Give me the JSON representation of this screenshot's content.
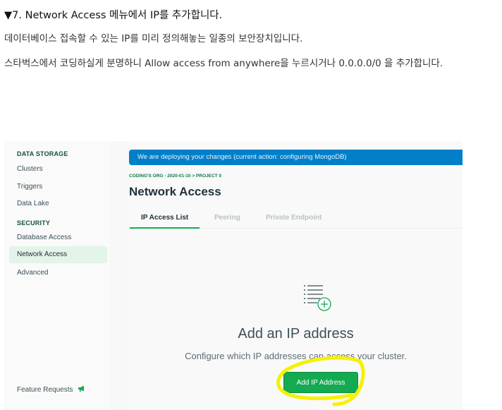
{
  "article": {
    "heading": "▼7. Network Access 메뉴에서 IP를 추가합니다.",
    "para1": "데이터베이스 접속할 수 있는 IP를 미리 정의해놓는 일종의 보안장치입니다.",
    "para2": "스타벅스에서 코딩하실게 분명하니 Allow access from anywhere을 누르시거나 0.0.0.0/0 을 추가합니다."
  },
  "sidebar": {
    "data_storage": "DATA STORAGE",
    "clusters": "Clusters",
    "triggers": "Triggers",
    "data_lake": "Data Lake",
    "security": "SECURITY",
    "database_access": "Database Access",
    "network_access": "Network Access",
    "advanced": "Advanced",
    "feature_requests": "Feature Requests"
  },
  "main": {
    "banner": "We are deploying your changes (current action: configuring MongoDB)",
    "breadcrumb": "CODING'S ORG - 2020-01-10 > PROJECT 0",
    "title": "Network Access",
    "tabs": [
      "IP Access List",
      "Peering",
      "Private Endpoint"
    ],
    "empty_title": "Add an IP address",
    "empty_desc": "Configure which IP addresses can access your cluster.",
    "add_button": "Add IP Address"
  },
  "colors": {
    "accent": "#13aa52",
    "banner": "#017fc9",
    "highlight": "#f5f200"
  },
  "icons": {
    "feature_requests": "megaphone-icon",
    "empty_state": "list-add-icon"
  }
}
